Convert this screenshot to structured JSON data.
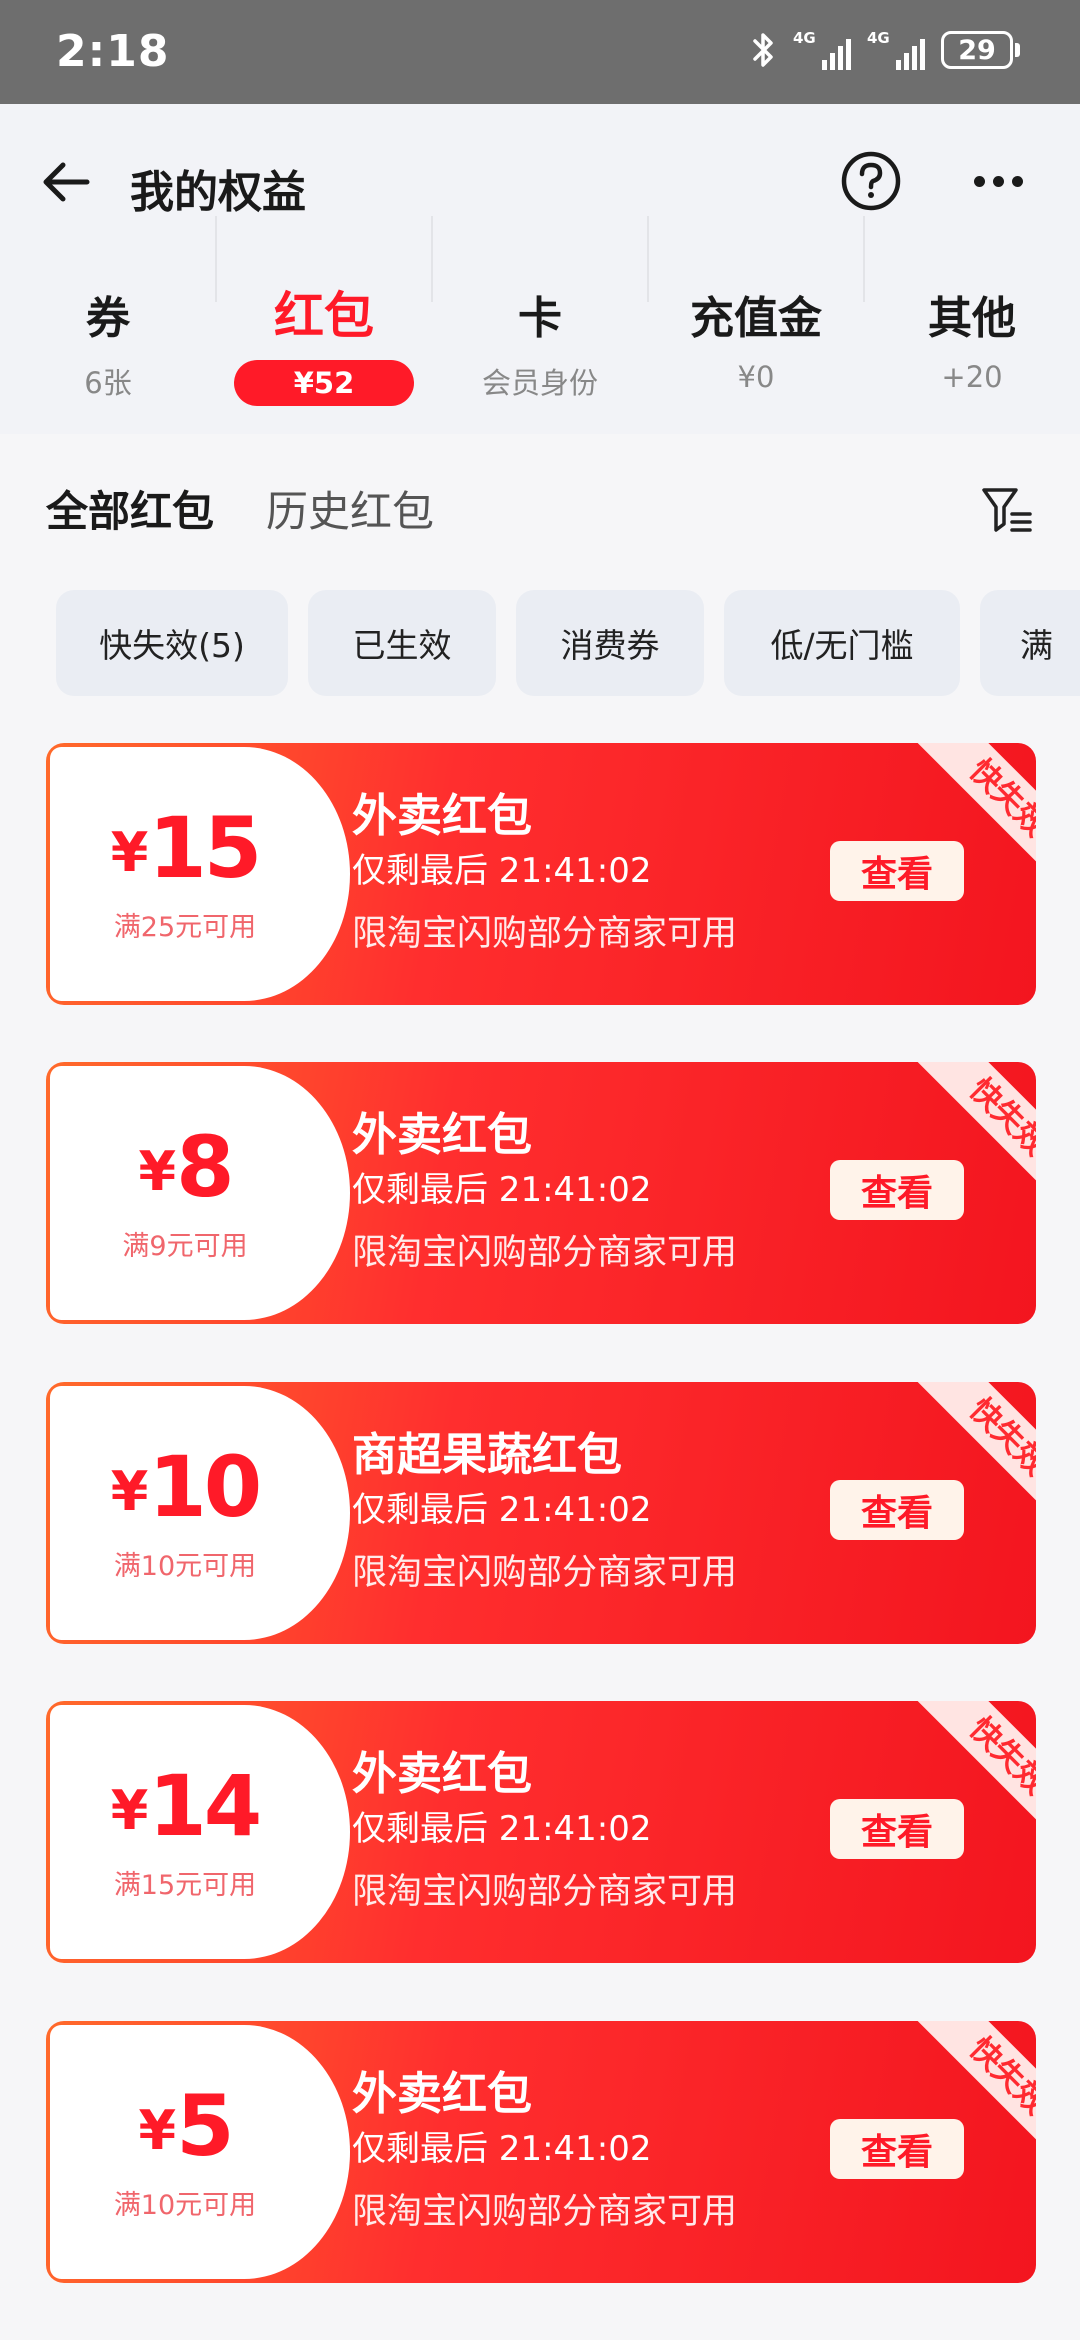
{
  "status_bar": {
    "time": "2:18",
    "network1": "4G",
    "network2": "4G",
    "battery": "29"
  },
  "header": {
    "title": "我的权益",
    "categories": [
      {
        "title": "券",
        "sub": "6张"
      },
      {
        "title": "红包",
        "sub": "¥52"
      },
      {
        "title": "卡",
        "sub": "会员身份"
      },
      {
        "title": "充值金",
        "sub": "¥0"
      },
      {
        "title": "其他",
        "sub": "+20"
      }
    ]
  },
  "subtabs": {
    "active": "全部红包",
    "inactive": "历史红包"
  },
  "chips": [
    "快失效(5)",
    "已生效",
    "消费券",
    "低/无门槛",
    "满"
  ],
  "coupons": [
    {
      "currency": "¥",
      "amount": "15",
      "condition": "满25元可用",
      "name": "外卖红包",
      "time": "仅剩最后 21:41:02",
      "desc": "限淘宝闪购部分商家可用",
      "button": "查看",
      "badge": "快失效"
    },
    {
      "currency": "¥",
      "amount": "8",
      "condition": "满9元可用",
      "name": "外卖红包",
      "time": "仅剩最后 21:41:02",
      "desc": "限淘宝闪购部分商家可用",
      "button": "查看",
      "badge": "快失效"
    },
    {
      "currency": "¥",
      "amount": "10",
      "condition": "满10元可用",
      "name": "商超果蔬红包",
      "time": "仅剩最后 21:41:02",
      "desc": "限淘宝闪购部分商家可用",
      "button": "查看",
      "badge": "快失效"
    },
    {
      "currency": "¥",
      "amount": "14",
      "condition": "满15元可用",
      "name": "外卖红包",
      "time": "仅剩最后 21:41:02",
      "desc": "限淘宝闪购部分商家可用",
      "button": "查看",
      "badge": "快失效"
    },
    {
      "currency": "¥",
      "amount": "5",
      "condition": "满10元可用",
      "name": "外卖红包",
      "time": "仅剩最后 21:41:02",
      "desc": "限淘宝闪购部分商家可用",
      "button": "查看",
      "badge": "快失效"
    }
  ],
  "colors": {
    "accent": "#ff1a28",
    "coupon_gradient_start": "#ff6a2b",
    "coupon_gradient_end": "#f3151f",
    "header_bg": "#f2f3f7",
    "status_bar_bg": "#6e6e6e"
  }
}
